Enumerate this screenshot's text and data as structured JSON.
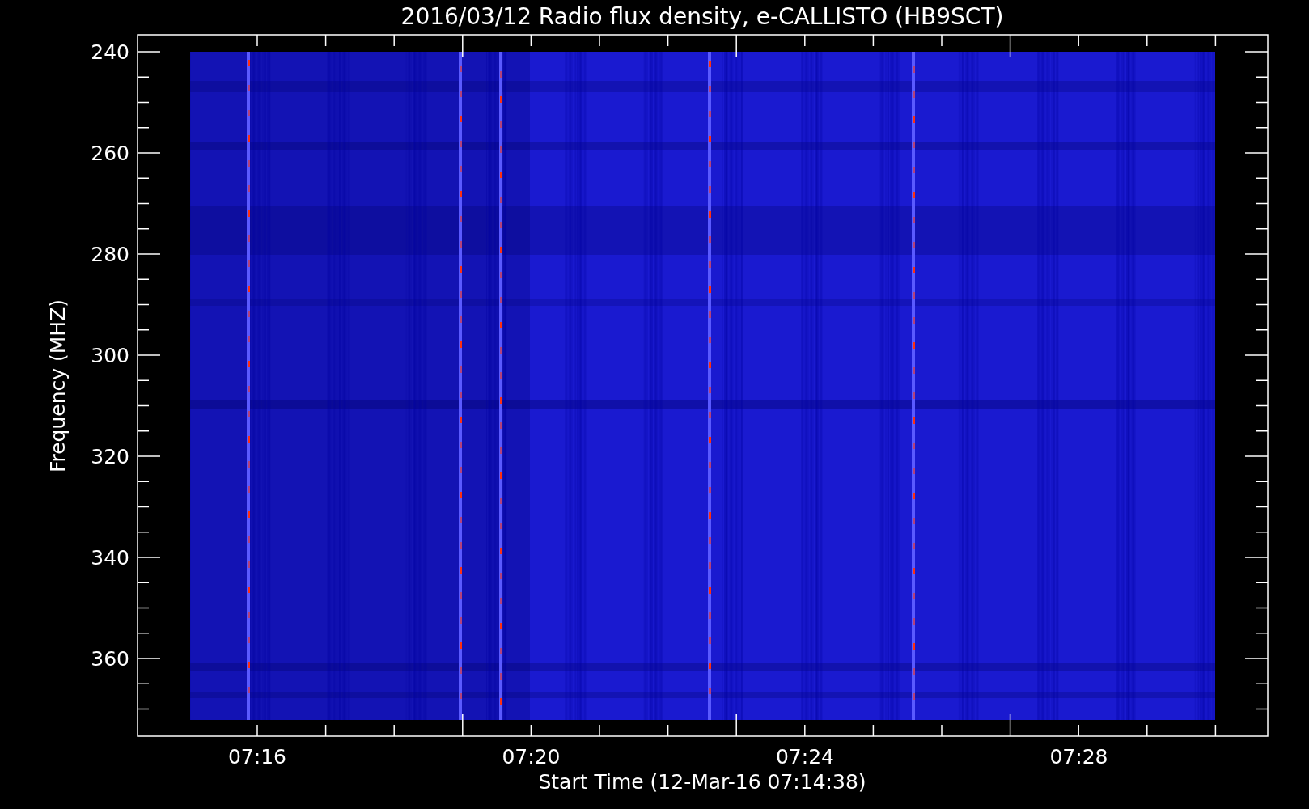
{
  "plot": {
    "title": "2016/03/12  Radio flux density, e-CALLISTO (HB9SCT)",
    "ylabel": "Frequency (MHZ)",
    "xlabel": "Start Time (12-Mar-16 07:14:38)",
    "yticks": [
      "240",
      "260",
      "280",
      "300",
      "320",
      "340",
      "360"
    ],
    "xticks": [
      "07:16",
      "07:20",
      "07:24",
      "07:28"
    ]
  }
}
